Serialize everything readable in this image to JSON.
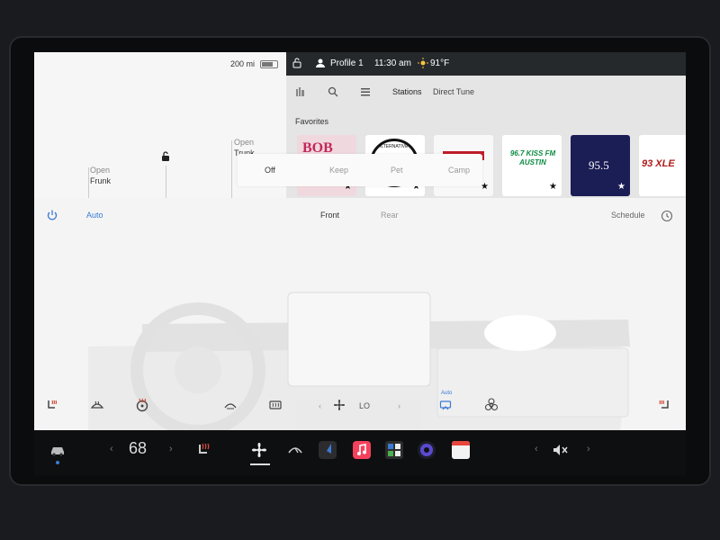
{
  "car": {
    "range": "200 mi",
    "battery_level": 0.75,
    "frunk_action": "Open",
    "frunk_label": "Frunk",
    "trunk_action": "Open",
    "trunk_label": "Trunk"
  },
  "statusbar": {
    "profile": "Profile 1",
    "time": "11:30 am",
    "temperature": "91°F"
  },
  "media": {
    "tabs": [
      "Stations",
      "Direct Tune"
    ],
    "favorites_label": "Favorites",
    "stations": [
      {
        "name": "BOB",
        "bg": "#f0d9de",
        "color": "#c2285b"
      },
      {
        "name": "ALTERNATIVE",
        "bg": "#ffffff",
        "color": "#111111"
      },
      {
        "name": "",
        "bg": "#f8f8f8",
        "color": "#c01d2a"
      },
      {
        "name": "96.7 KISS FM AUSTIN",
        "bg": "#ffffff",
        "color": "#0d8c43"
      },
      {
        "name": "95.5",
        "bg": "#1b1d55",
        "color": "#ffffff"
      },
      {
        "name": "93 XLE",
        "bg": "#ffffff",
        "color": "#b01a1a"
      }
    ]
  },
  "camp_mode": {
    "options": [
      "Off",
      "Keep",
      "Pet",
      "Camp"
    ]
  },
  "climate": {
    "auto_label": "Auto",
    "front_label": "Front",
    "rear_label": "Rear",
    "schedule_label": "Schedule",
    "fan_level": "LO",
    "airflow_auto_label": "Auto"
  },
  "dock": {
    "temperature": "68"
  },
  "colors": {
    "accent_blue": "#3a7bd5",
    "statusbar_bg": "#26292c",
    "dock_bg": "#0e0f11"
  }
}
